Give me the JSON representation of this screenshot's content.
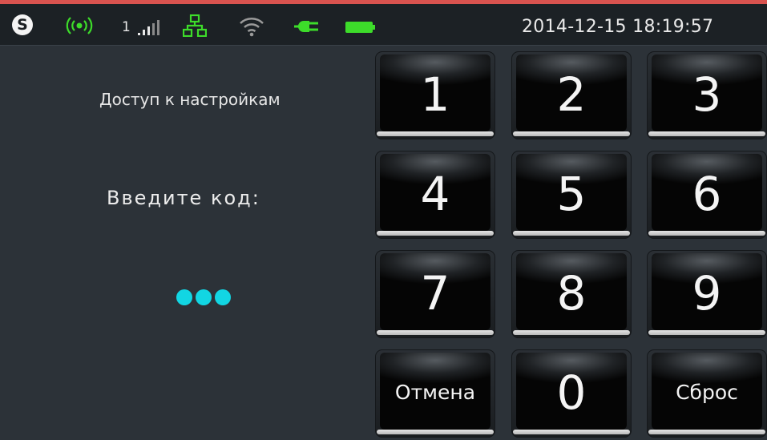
{
  "status_bar": {
    "logo_icon": "s-logo-icon",
    "sim_slot": "1",
    "clock": "2014-12-15 18:19:57",
    "icons": [
      "radio-signal-icon",
      "cellular-signal-icon",
      "network-icon",
      "wifi-icon",
      "power-plug-icon",
      "battery-icon"
    ],
    "accent_color": "#d9534f",
    "indicator_green": "#3ddc2a"
  },
  "dialog": {
    "title": "Доступ к настройкам",
    "prompt": "Введите код:",
    "entered_digits_count": 3,
    "dot_color": "#12d6e3"
  },
  "keypad": {
    "key_1": "1",
    "key_2": "2",
    "key_3": "3",
    "key_4": "4",
    "key_5": "5",
    "key_6": "6",
    "key_7": "7",
    "key_8": "8",
    "key_9": "9",
    "key_0": "0",
    "cancel": "Отмена",
    "reset": "Сброс"
  }
}
